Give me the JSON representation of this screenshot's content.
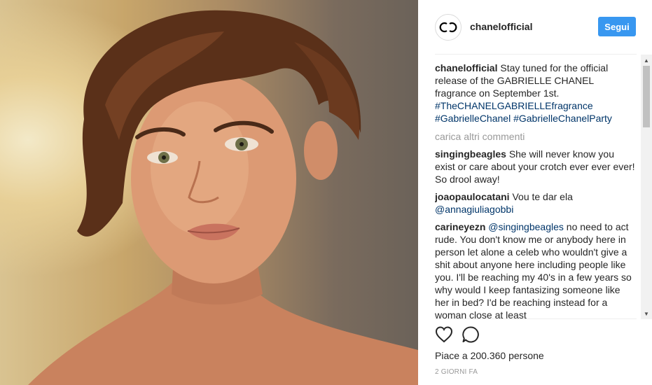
{
  "post": {
    "image_alt": "portrait photo",
    "header_username": "chanelofficial",
    "follow_label": "Segui",
    "caption": {
      "user": "chanelofficial",
      "text": "Stay tuned for the official release of the GABRIELLE CHANEL fragrance on September 1st.",
      "tags": [
        "#TheCHANELGABRIELLEfragrance",
        "#GabrielleChanel",
        "#GabrielleChanelParty"
      ]
    },
    "load_more": "carica altri commenti",
    "comments": [
      {
        "user": "singingbeagles",
        "text": "She will never know you exist or care about your crotch ever ever ever! So drool away!"
      },
      {
        "user": "joaopaulocatani",
        "text": "Vou te dar ela",
        "mention": "@annagiuliagobbi"
      },
      {
        "user": "carineyezn",
        "mention": "@singingbeagles",
        "text": "no need to act rude. You don't know me or anybody here in person let alone a celeb who wouldn't give a shit about anyone here including people like you. I'll be reaching my 40's in a few years so why would I keep fantasizing someone like her in bed? I'd be reaching instead for a woman close at least"
      }
    ],
    "likes": "Piace a 200.360 persone",
    "time": "2 GIORNI FA"
  },
  "icons": [
    "chanel-logo-icon",
    "heart-icon",
    "comment-icon",
    "scroll-up-icon",
    "scroll-down-icon"
  ],
  "colors": {
    "follow_button": "#3897f0",
    "link": "#003569",
    "muted": "#999999"
  }
}
